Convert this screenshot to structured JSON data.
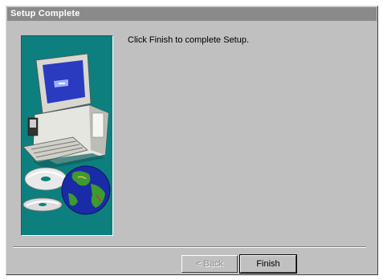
{
  "window": {
    "title": "Setup Complete"
  },
  "main": {
    "message": "Click Finish to complete Setup."
  },
  "buttons": {
    "back_label": "< Back",
    "finish_label": "Finish"
  },
  "side_panel": {
    "background_color": "#0d7f7e",
    "illustration_icons": [
      "computer-icon",
      "cd-discs-icon",
      "globe-icon"
    ]
  }
}
